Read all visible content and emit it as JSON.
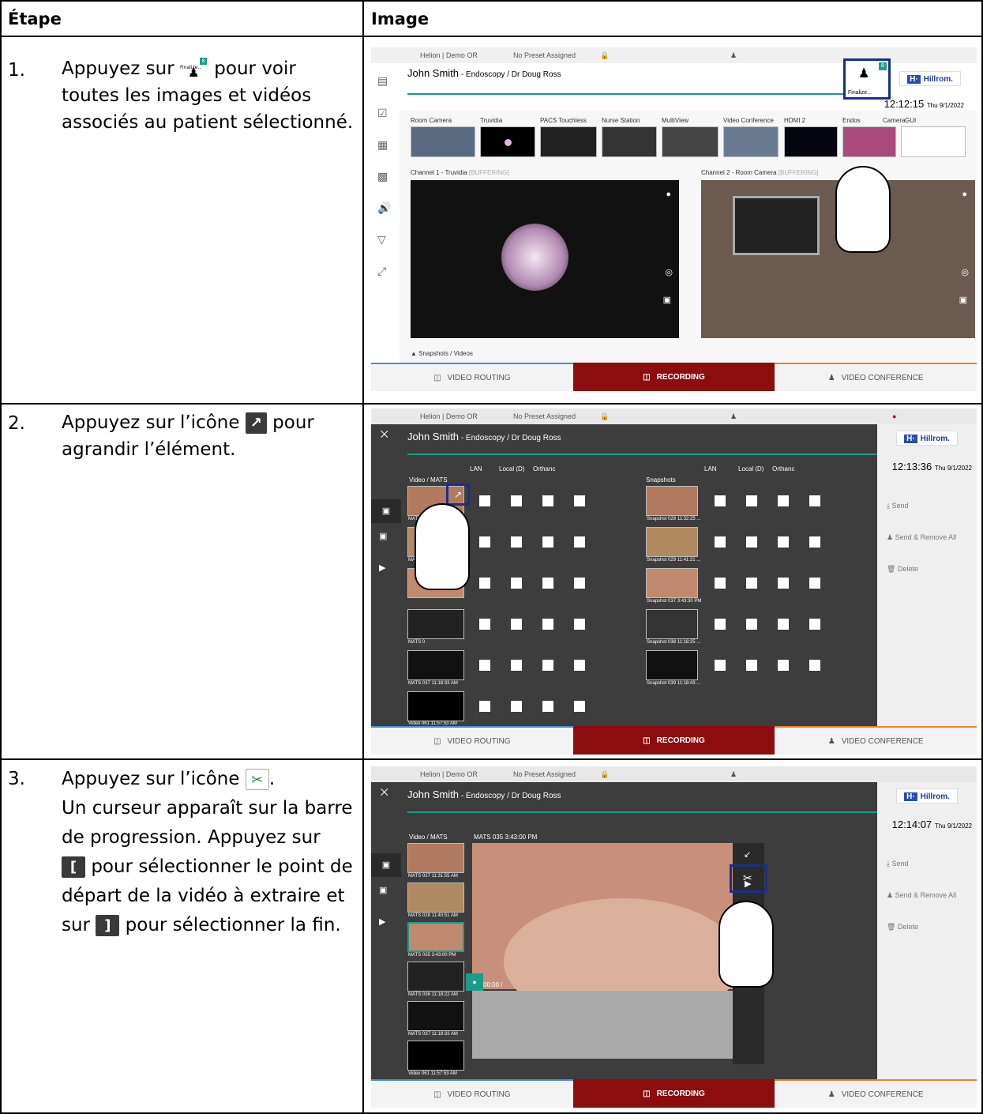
{
  "header": {
    "col_step": "Étape",
    "col_image": "Image"
  },
  "steps": [
    {
      "num": "1.",
      "before": "Appuyez sur",
      "icon_label": "Finalize...",
      "icon_badge": "8",
      "after": "pour voir toutes les images et vidéos associés au patient sélectionné."
    },
    {
      "num": "2.",
      "before": "Appuyez sur l’icône",
      "icon_glyph": "↗",
      "after": "pour agrandir l’élément."
    },
    {
      "num": "3.",
      "line1_before": "Appuyez sur l’icône",
      "line1_after": ".",
      "line2": "Un curseur apparaît sur la barre de progression. Appuyez sur",
      "start_glyph": "[",
      "line3": "pour sélectionner le point de départ de la vidéo à extraire et sur",
      "end_glyph": "]",
      "line4": "pour sélectionner la fin."
    }
  ],
  "ui": {
    "room": "Helion | Demo OR",
    "preset": "No Preset Assigned",
    "patient_name": "John Smith",
    "patient_proc": " - Endoscopy / Dr Doug Ross",
    "brand": "Hillrom.",
    "brand_mark": "H·",
    "tab_routing": "VIDEO ROUTING",
    "tab_recording": "RECORDING",
    "tab_conference": "VIDEO CONFERENCE",
    "finalize": "Finalize...",
    "badge": "8"
  },
  "shot1": {
    "time": "12:12:15",
    "date": "Thu 9/1/2022",
    "sources": [
      "Room Camera",
      "Truvidia",
      "PACS Touchless",
      "Nurse Station",
      "MultiView",
      "Video Conference",
      "HDMI 2",
      "Endos",
      "Camera",
      "GUI"
    ],
    "ch1": "Channel 1 - Truvidia",
    "ch2": "Channel 2 - Room Camera",
    "buffering": "[BUFFERING]",
    "snapshots": "Snapshots / Videos"
  },
  "shot2": {
    "time": "12:13:36",
    "date": "Thu 9/1/2022",
    "video_col": "Video / MATS",
    "snap_col": "Snapshots",
    "dest": [
      "LAN",
      "Local (D)",
      "Orthanc"
    ],
    "videos": [
      "MATS 027 11:31:55",
      "MATS 028",
      "MATS 0",
      "MATS 037 11:18:33 AM",
      "Video 061 11:57:53 AM"
    ],
    "snaps": [
      "Snapshot 028 11:32:25 ...",
      "Snapshot 029 11:41:21 ...",
      "Snapshot 037 3:43:30 PM",
      "Snapshot 038 11:18:25 ...",
      "Snapshot 039 11:18:43 ..."
    ],
    "send": "Send",
    "send_remove": "Send & Remove All",
    "delete": "Delete"
  },
  "shot3": {
    "time": "12:14:07",
    "date": "Thu 9/1/2022",
    "video_col": "Video / MATS",
    "current": "MATS 035 3:43:00 PM",
    "videos": [
      "MATS 027 11:31:55 AM",
      "MATS 028 11:40:51 AM",
      "MATS 035 3:43:00 PM",
      "MATS 036 11:18:22 AM",
      "MATS 037 11:18:33 AM",
      "Video 061 11:57:53 AM"
    ],
    "progress": "00:00 /",
    "send": "Send",
    "send_remove": "Send & Remove All",
    "delete": "Delete"
  },
  "colors": {
    "recording": "#8b0d0d",
    "accent": "#1a9c8a",
    "highlight": "#1a2f8c",
    "brand": "#2a4db0"
  }
}
